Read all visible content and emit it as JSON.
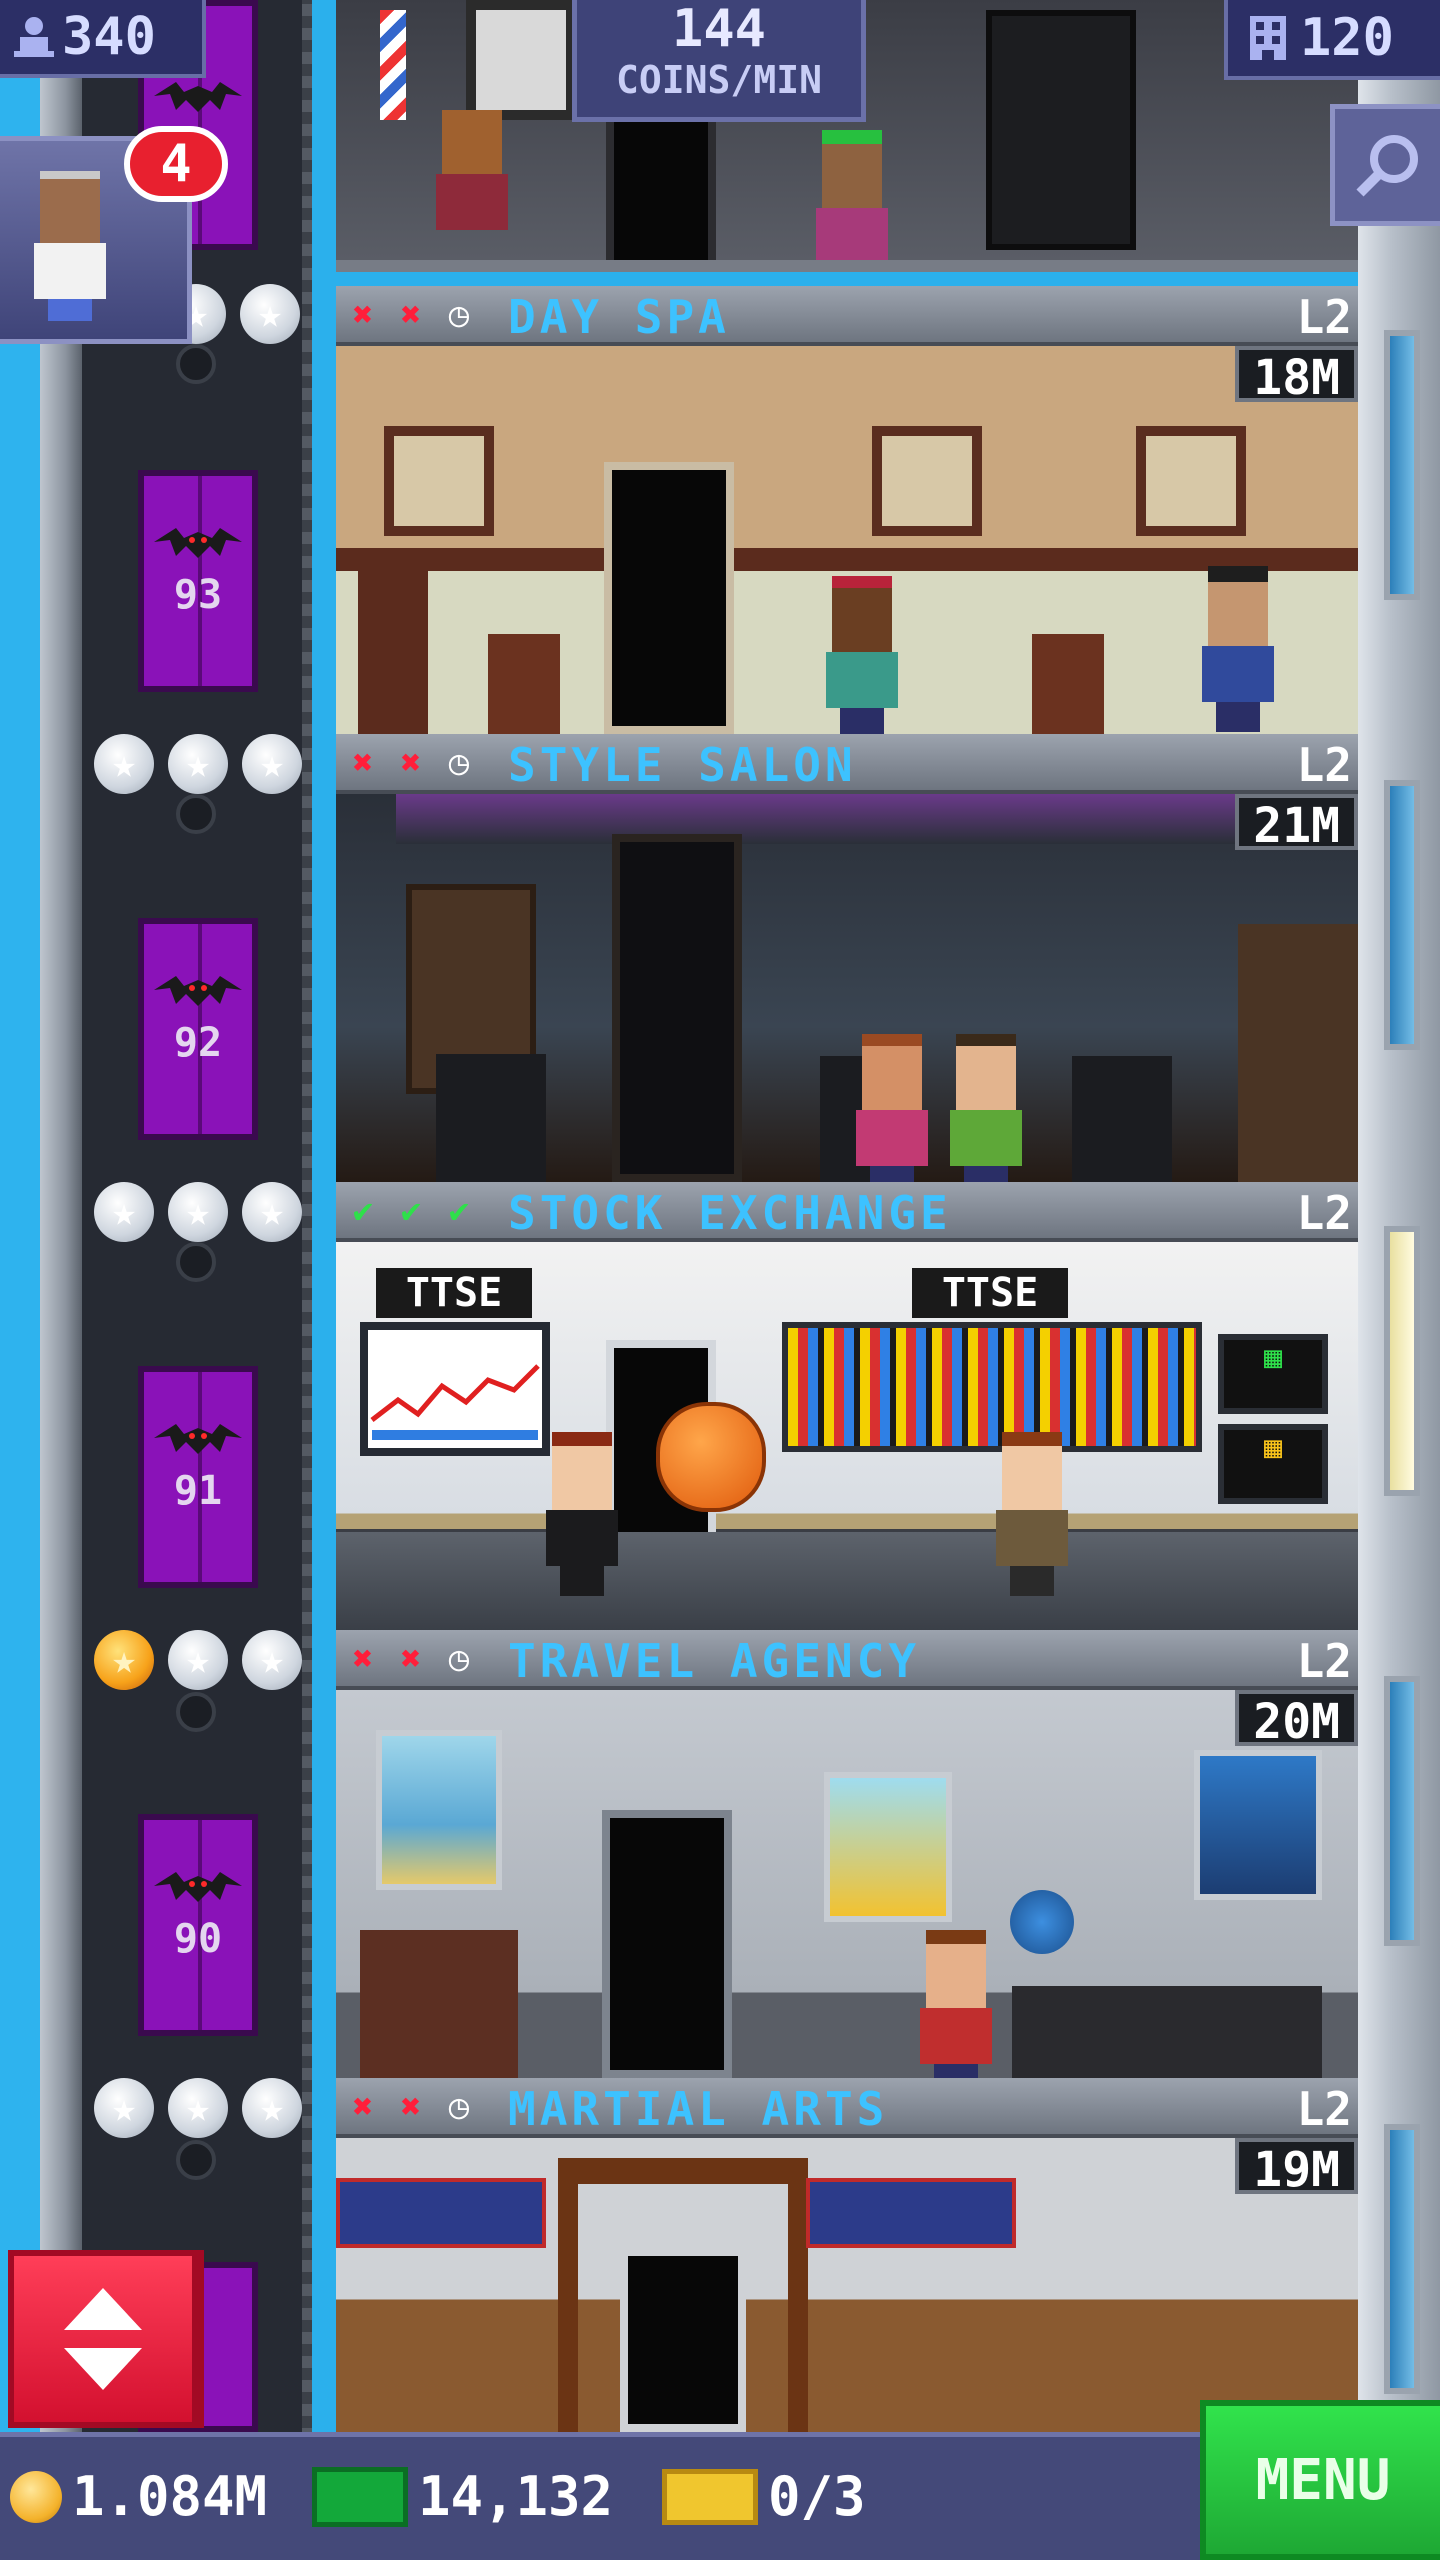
{
  "hud": {
    "population": "340",
    "coins_per_min_value": "144",
    "coins_per_min_unit": "COINS/MIN",
    "floors": "120",
    "visitor_notifications": "4"
  },
  "floors": [
    {
      "name": "DAY SPA",
      "level": "L2",
      "timer": "18M",
      "status": [
        "x",
        "x",
        "clock"
      ],
      "elevator_floor": "93",
      "stars": [
        "silver",
        "silver",
        "silver"
      ]
    },
    {
      "name": "STYLE SALON",
      "level": "L2",
      "timer": "21M",
      "status": [
        "x",
        "x",
        "clock"
      ],
      "elevator_floor": "92",
      "stars": [
        "silver",
        "silver",
        "silver"
      ]
    },
    {
      "name": "STOCK EXCHANGE",
      "level": "L2",
      "timer": "",
      "status": [
        "check",
        "check",
        "check"
      ],
      "elevator_floor": "91",
      "stars": [
        "silver",
        "silver",
        "silver"
      ],
      "signs": [
        "TTSE",
        "TTSE"
      ]
    },
    {
      "name": "TRAVEL AGENCY",
      "level": "L2",
      "timer": "20M",
      "status": [
        "x",
        "x",
        "clock"
      ],
      "elevator_floor": "90",
      "stars": [
        "gold",
        "silver",
        "silver"
      ]
    },
    {
      "name": "MARTIAL ARTS",
      "level": "L2",
      "timer": "19M",
      "status": [
        "x",
        "x",
        "clock"
      ],
      "elevator_floor": "",
      "stars": [
        "silver",
        "silver",
        "silver"
      ]
    }
  ],
  "bottom_bar": {
    "coins": "1.084M",
    "bux": "14,132",
    "tickets": "0/3",
    "menu_label": "MENU"
  },
  "icons": {
    "population": "person-icon",
    "floors": "building-icon",
    "search": "magnifier-icon",
    "elevator": "up-down-arrows-icon",
    "coin": "coin-icon",
    "bux": "bux-icon",
    "ticket": "golden-ticket-icon"
  },
  "colors": {
    "floor_name": "#3dc2ff",
    "elevator_door": "#8a12b8",
    "menu_button": "#22c53b",
    "elevator_button": "#e51c3a",
    "notification": "#e8202f"
  }
}
